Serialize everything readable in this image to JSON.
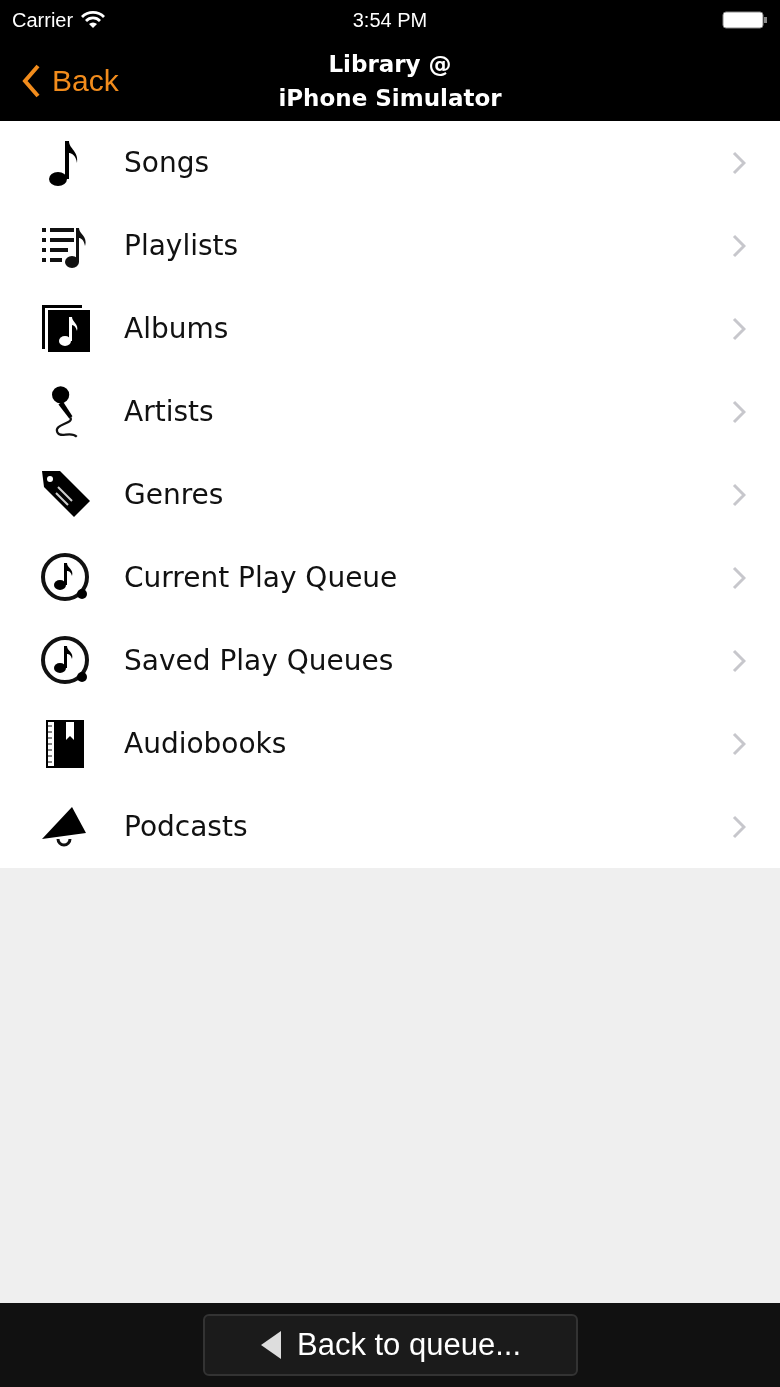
{
  "status_bar": {
    "carrier": "Carrier",
    "time": "3:54 PM"
  },
  "nav_bar": {
    "back": "Back",
    "title_line_1": "Library @",
    "title_line_2": "iPhone Simulator"
  },
  "items": [
    {
      "kind": "songs",
      "label": "Songs"
    },
    {
      "kind": "playlists",
      "label": "Playlists"
    },
    {
      "kind": "albums",
      "label": "Albums"
    },
    {
      "kind": "artists",
      "label": "Artists"
    },
    {
      "kind": "genres",
      "label": "Genres"
    },
    {
      "kind": "queue",
      "label": "Current Play Queue"
    },
    {
      "kind": "queue",
      "label": "Saved Play Queues"
    },
    {
      "kind": "audiobooks",
      "label": "Audiobooks"
    },
    {
      "kind": "podcasts",
      "label": "Podcasts"
    }
  ],
  "bottom_button": {
    "label": "Back to queue..."
  }
}
